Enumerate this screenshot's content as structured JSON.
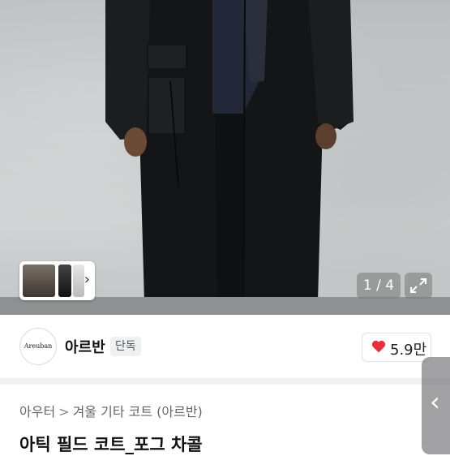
{
  "gallery": {
    "counter": "1 / 4",
    "current": 1,
    "total": 4,
    "next_icon": "chevron-right-icon",
    "expand_icon": "expand-icon"
  },
  "seller": {
    "logo_text": "Areuban",
    "name": "아르반",
    "badge": "단독"
  },
  "likes": {
    "count": "5.9만",
    "heart_color": "#e8303c"
  },
  "breadcrumb": {
    "items": [
      "아우터",
      "겨울 기타 코트 (아르반)"
    ],
    "separator": ">"
  },
  "product": {
    "title": "아틱 필드 코트_포그 차콜"
  },
  "side_handle": {
    "icon": "chevron-left-icon"
  }
}
